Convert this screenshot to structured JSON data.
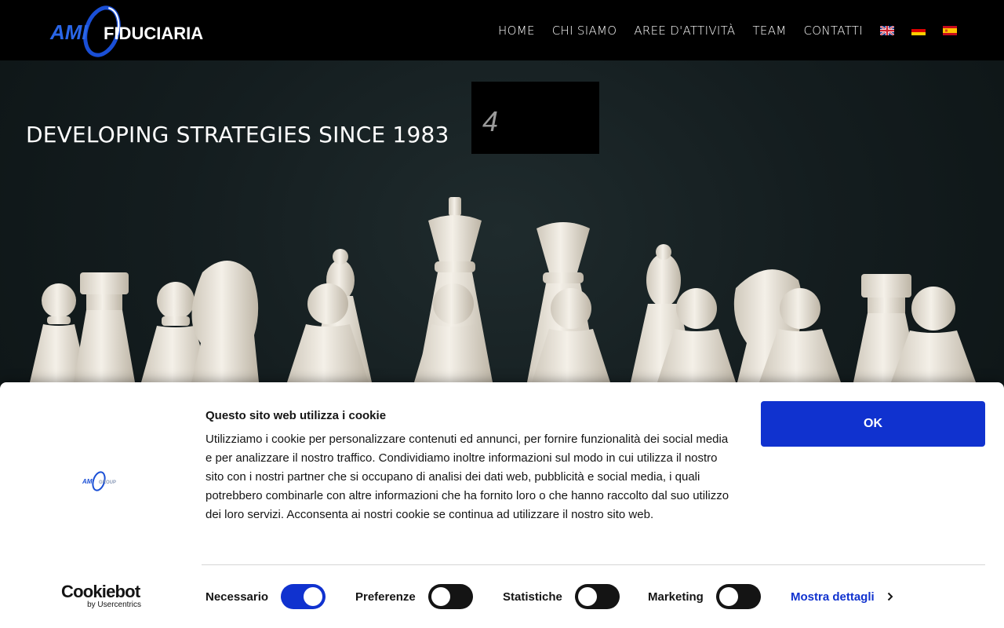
{
  "header": {
    "logo_text": "AMI FIDUCIARIA",
    "nav": [
      "HOME",
      "CHI SIAMO",
      "AREE D'ATTIVITÀ",
      "TEAM",
      "CONTATTI"
    ],
    "flags": [
      "flag-uk-icon",
      "flag-de-icon",
      "flag-es-icon"
    ]
  },
  "hero": {
    "title": "DEVELOPING STRATEGIES SINCE 1983",
    "box_number": "4"
  },
  "cookie": {
    "logo_text": "AMI GROUP",
    "title": "Questo sito web utilizza i cookie",
    "text": "Utilizziamo i cookie per personalizzare contenuti ed annunci, per fornire funzionalità dei social media e per analizzare il nostro traffico. Condividiamo inoltre informazioni sul modo in cui utilizza il nostro sito con i nostri partner che si occupano di analisi dei dati web, pubblicità e social media, i quali potrebbero combinarle con altre informazioni che ha fornito loro o che hanno raccolto dal suo utilizzo dei loro servizi. Acconsenta ai nostri cookie se continua ad utilizzare il nostro sito web.",
    "ok_label": "OK",
    "brand": "Cookiebot",
    "brand_sub": "by Usercentrics",
    "categories": [
      {
        "label": "Necessario",
        "enabled": true
      },
      {
        "label": "Preferenze",
        "enabled": false
      },
      {
        "label": "Statistiche",
        "enabled": false
      },
      {
        "label": "Marketing",
        "enabled": false
      }
    ],
    "details_label": "Mostra dettagli"
  },
  "colors": {
    "accent": "#1032cf",
    "header_bg": "#000000",
    "hero_bg": "#141d1f"
  }
}
